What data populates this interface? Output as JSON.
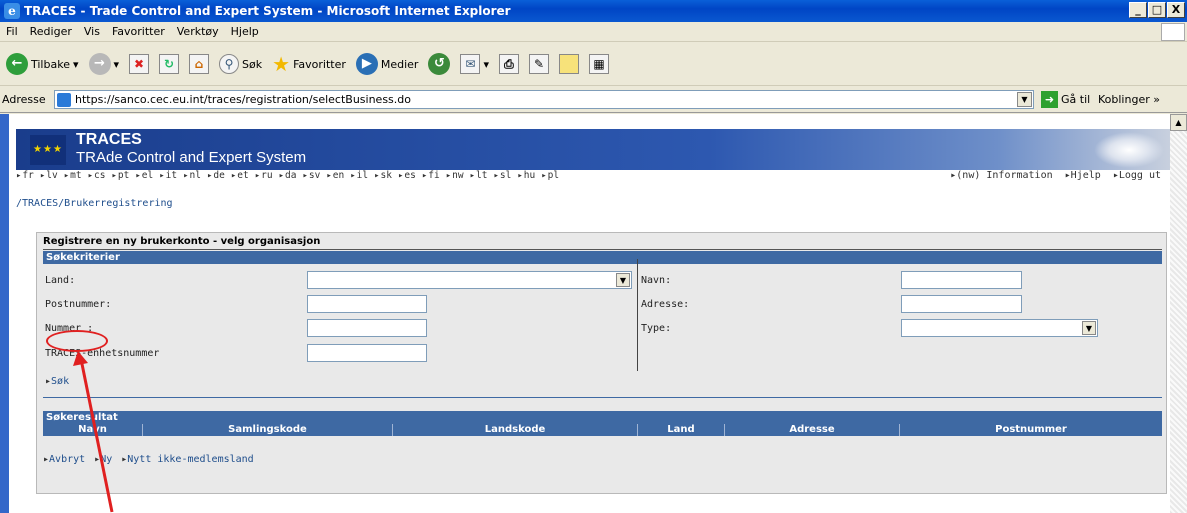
{
  "window": {
    "title": "TRACES - Trade Control and Expert System - Microsoft Internet Explorer",
    "controls": [
      "_",
      "□",
      "X"
    ]
  },
  "menu": [
    "Fil",
    "Rediger",
    "Vis",
    "Favoritter",
    "Verktøy",
    "Hjelp"
  ],
  "toolbar": {
    "back": "Tilbake",
    "search": "Søk",
    "favorites": "Favoritter",
    "media": "Medier"
  },
  "address": {
    "label": "Adresse",
    "url": "https://sanco.cec.eu.int/traces/registration/selectBusiness.do",
    "go": "Gå til",
    "links": "Koblinger"
  },
  "banner": {
    "title": "TRACES",
    "subtitle": "TRAde Control and Expert System"
  },
  "languages": [
    "fr",
    "lv",
    "mt",
    "cs",
    "pt",
    "el",
    "it",
    "nl",
    "de",
    "et",
    "ru",
    "da",
    "sv",
    "en",
    "il",
    "sk",
    "es",
    "fi",
    "nw",
    "lt",
    "sl",
    "hu",
    "pl"
  ],
  "toplinks": [
    "(nw) Information",
    "Hjelp",
    "Logg ut"
  ],
  "breadcrumb": "/TRACES/Brukerregistrering",
  "page": {
    "title": "Registrere en ny brukerkonto - velg organisasjon",
    "search_section": "Søkekriterier",
    "labels": {
      "country": "Land:",
      "postcode": "Postnummer:",
      "number": "Nummer :",
      "traces_unit": "TRACES-enhetsnummer",
      "name": "Navn:",
      "address": "Adresse:",
      "type": "Type:"
    },
    "search_link": "Søk",
    "results_section": "Søkeresultat",
    "columns": [
      "Navn",
      "Samlingskode",
      "Landskode",
      "Land",
      "Adresse",
      "Postnummer"
    ],
    "actions": [
      "Avbryt",
      "Ny",
      "Nytt ikke-medlemsland"
    ]
  }
}
